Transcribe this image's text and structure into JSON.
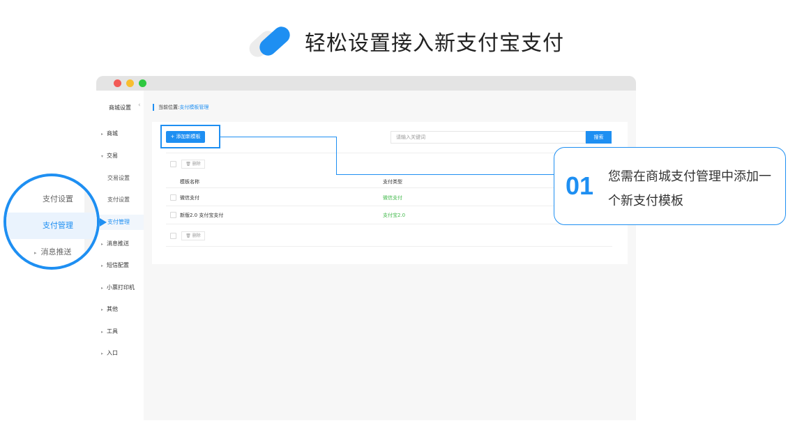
{
  "heading": {
    "title": "轻松设置接入新支付宝支付"
  },
  "sidebar": {
    "head": "商城设置",
    "collapse_icon": "‹",
    "items": [
      {
        "label": "商城",
        "caret": "▸"
      },
      {
        "label": "交易",
        "caret": "▾"
      },
      {
        "label": "交易设置"
      },
      {
        "label": "支付设置"
      },
      {
        "label": "支付管理"
      },
      {
        "label": "消息推送",
        "caret": "▸"
      },
      {
        "label": "短信配置",
        "caret": "▸"
      },
      {
        "label": "小票打印机",
        "caret": "▸"
      },
      {
        "label": "其他",
        "caret": "▸"
      },
      {
        "label": "工具",
        "caret": "▸"
      },
      {
        "label": "入口",
        "caret": "▸"
      }
    ]
  },
  "breadcrumb": {
    "prefix": "当前位置:",
    "current": "支付模板管理"
  },
  "toolbar": {
    "add_label": "+ 添加新模板",
    "search_placeholder": "请输入关键词",
    "search_label": "搜索",
    "delete_label": "🗑 删除"
  },
  "table": {
    "headers": [
      "模板名称",
      "支付类型"
    ],
    "rows": [
      {
        "name": "微信支付",
        "type": "微信支付"
      },
      {
        "name": "新版2.0 支付宝支付",
        "type": "支付宝2.0"
      }
    ]
  },
  "callout": {
    "number": "01",
    "text": "您需在商城支付管理中添加一个新支付模板"
  },
  "magnifier": {
    "items": [
      {
        "label": "支付设置"
      },
      {
        "label": "支付管理"
      },
      {
        "label": "消息推送",
        "caret": "▸"
      }
    ]
  },
  "colors": {
    "accent": "#1e8ff2",
    "success": "#42b94b"
  }
}
